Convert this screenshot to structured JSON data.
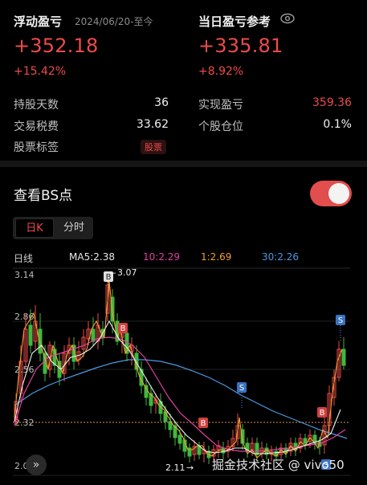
{
  "summary": {
    "float_title": "浮动盈亏",
    "float_date": "2024/06/20-至今",
    "float_value": "+352.18",
    "float_pct": "+15.42%",
    "day_title": "当日盈亏参考",
    "day_value": "+335.81",
    "day_pct": "+8.92%"
  },
  "details": {
    "hold_days_label": "持股天数",
    "hold_days": "36",
    "realized_label": "实现盈亏",
    "realized": "359.36",
    "tax_label": "交易税费",
    "tax": "33.62",
    "position_label": "个股仓位",
    "position": "0.1%",
    "tag_label": "股票标签",
    "tag": "股票"
  },
  "bs": {
    "title": "查看BS点",
    "toggle_on": true,
    "tabs": [
      "日K",
      "分时"
    ]
  },
  "legend": {
    "daily": "日线",
    "ma5": "MA5:2.38",
    "ma10": "10:2.29",
    "ma1": "1:2.69",
    "ma30": "30:2.26"
  },
  "chart_data": {
    "type": "candlestick",
    "y_labels": [
      "3.14",
      "2.86",
      "2.56",
      "2.32",
      "2.0"
    ],
    "annotations": {
      "high": "3.07",
      "low": "2.11"
    },
    "markers": [
      "B",
      "B",
      "S",
      "B",
      "B",
      "S",
      "S"
    ],
    "colors": {
      "up": "#ee4a4a",
      "down": "#3fb83f",
      "ma5": "#f0f0f0",
      "ma10": "#e040a0",
      "ma1": "#f0a030",
      "ma30": "#4a9ae0"
    }
  },
  "watermark": "掘金技术社区 @ vivo50"
}
